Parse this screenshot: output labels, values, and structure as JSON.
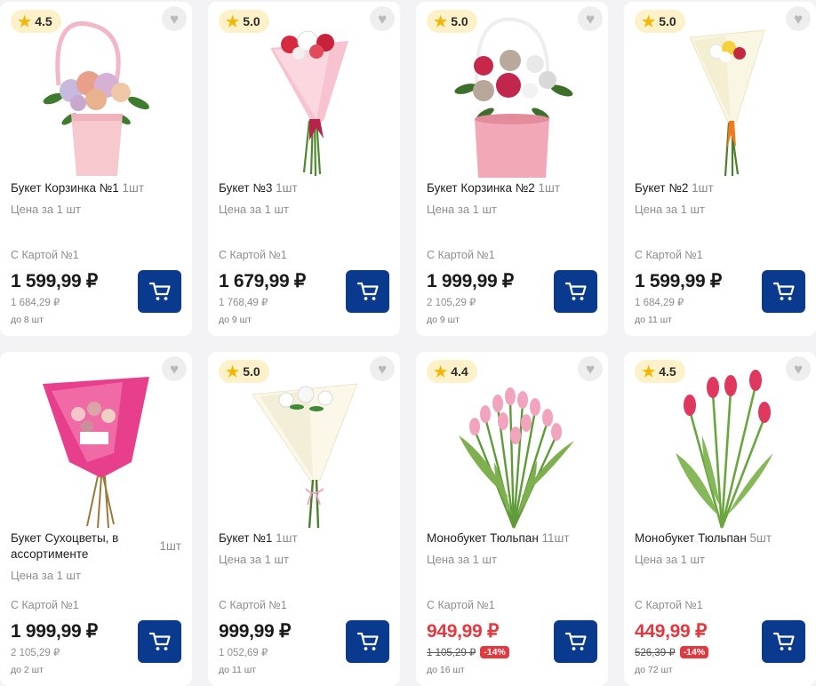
{
  "products": [
    {
      "rating": "4.5",
      "name": "Букет Корзинка №1",
      "qty": "1шт",
      "price_for": "Цена за 1 шт",
      "card_label": "С Картой №1",
      "price": "1 599,99 ₽",
      "old_price": "1 684,29 ₽",
      "discount": "",
      "stock": "до 8 шт"
    },
    {
      "rating": "5.0",
      "name": "Букет №3",
      "qty": "1шт",
      "price_for": "Цена за 1 шт",
      "card_label": "С Картой №1",
      "price": "1 679,99 ₽",
      "old_price": "1 768,49 ₽",
      "discount": "",
      "stock": "до 9 шт"
    },
    {
      "rating": "5.0",
      "name": "Букет Корзинка №2",
      "qty": "1шт",
      "price_for": "Цена за 1 шт",
      "card_label": "С Картой №1",
      "price": "1 999,99 ₽",
      "old_price": "2 105,29 ₽",
      "discount": "",
      "stock": "до 9 шт"
    },
    {
      "rating": "5.0",
      "name": "Букет №2",
      "qty": "1шт",
      "price_for": "Цена за 1 шт",
      "card_label": "С Картой №1",
      "price": "1 599,99 ₽",
      "old_price": "1 684,29 ₽",
      "discount": "",
      "stock": "до 11 шт"
    },
    {
      "rating": "",
      "name": "Букет Сухоцветы, в ассортименте",
      "qty": "1шт",
      "price_for": "Цена за 1 шт",
      "card_label": "С Картой №1",
      "price": "1 999,99 ₽",
      "old_price": "2 105,29 ₽",
      "discount": "",
      "stock": "до 2 шт"
    },
    {
      "rating": "5.0",
      "name": "Букет №1",
      "qty": "1шт",
      "price_for": "Цена за 1 шт",
      "card_label": "С Картой №1",
      "price": "999,99 ₽",
      "old_price": "1 052,69 ₽",
      "discount": "",
      "stock": "до 11 шт"
    },
    {
      "rating": "4.4",
      "name": "Монобукет Тюльпан",
      "qty": "11шт",
      "price_for": "Цена за 1 шт",
      "card_label": "С Картой №1",
      "price": "949,99 ₽",
      "old_price": "1 105,29 ₽",
      "discount": "-14%",
      "stock": "до 16 шт"
    },
    {
      "rating": "4.5",
      "name": "Монобукет Тюльпан",
      "qty": "5шт",
      "price_for": "Цена за 1 шт",
      "card_label": "С Картой №1",
      "price": "449,99 ₽",
      "old_price": "526,39 ₽",
      "discount": "-14%",
      "stock": "до 72 шт"
    }
  ],
  "icons": {
    "rating": "star-icon",
    "favorite": "heart-icon",
    "cart": "cart-icon"
  },
  "colors": {
    "accent": "#0a3a8e",
    "sale": "#e2393f",
    "rating_bg": "#fdf1c9",
    "star": "#f2b705"
  }
}
